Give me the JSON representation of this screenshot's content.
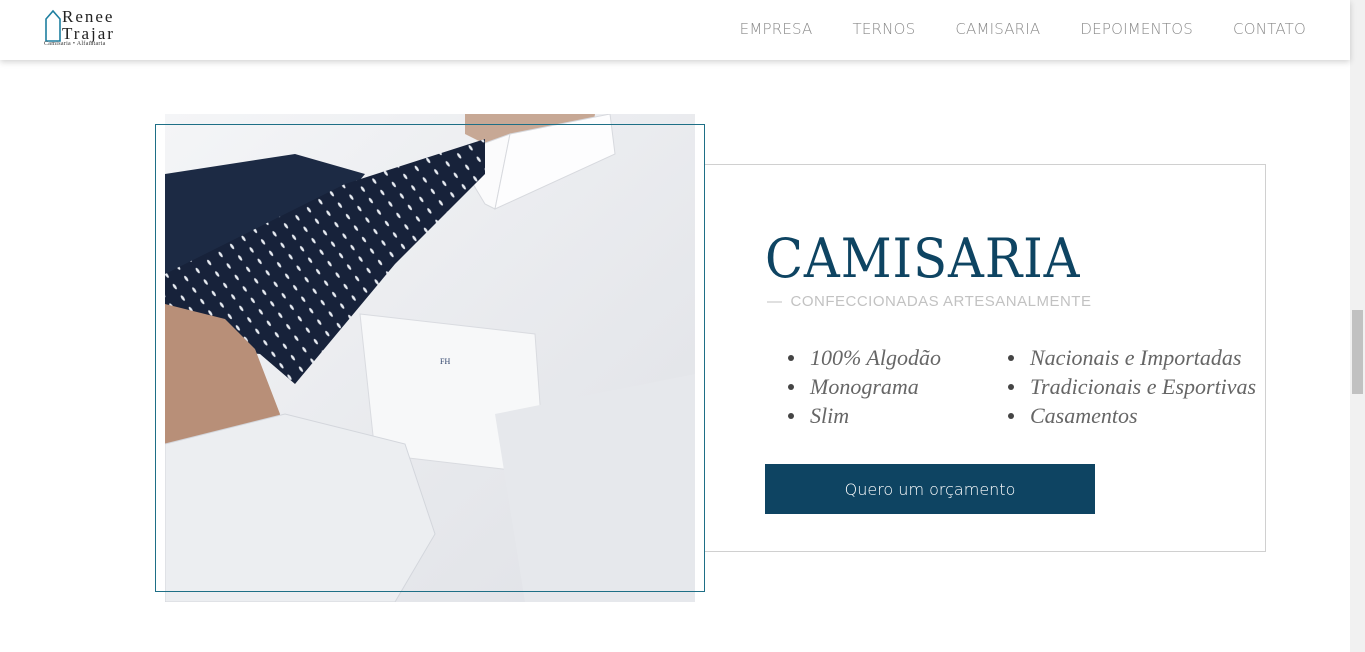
{
  "logo": {
    "line1": "Renee",
    "line2": "Trajar",
    "tagline": "Camisaria • Alfaiataria"
  },
  "nav": {
    "items": [
      {
        "label": "EMPRESA"
      },
      {
        "label": "TERNOS"
      },
      {
        "label": "CAMISARIA"
      },
      {
        "label": "DEPOIMENTOS"
      },
      {
        "label": "CONTATO"
      }
    ]
  },
  "section": {
    "title": "CAMISARIA",
    "subtitle_dash": "—",
    "subtitle": "CONFECCIONADAS ARTESANALMENTE",
    "features_left": [
      "100% Algodão",
      "Monograma",
      "Slim"
    ],
    "features_right": [
      "Nacionais e Importadas",
      "Tradicionais e Esportivas",
      "Casamentos"
    ],
    "cta_label": "Quero um orçamento",
    "monogram": "FH"
  },
  "colors": {
    "brand": "#0e4462",
    "frame": "#1e6f86",
    "nav_text": "#8a8a8a"
  }
}
